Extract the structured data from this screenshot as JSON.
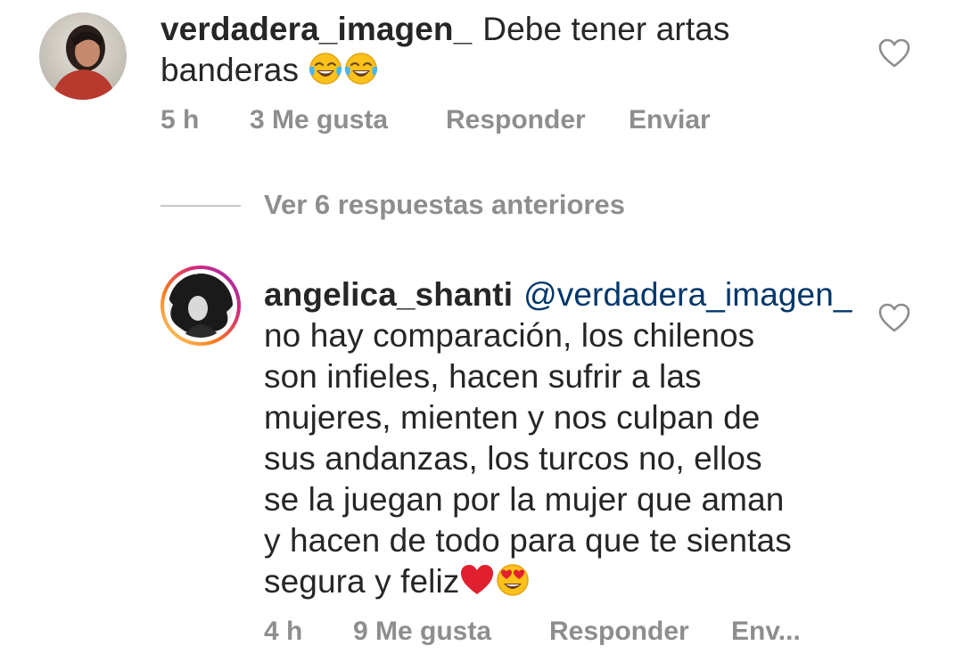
{
  "comment1": {
    "username": "verdadera_imagen_",
    "text_line1": "Debe tener artas",
    "text_line2": "banderas",
    "emojis": [
      "face-with-tears-of-joy-emoji",
      "face-with-tears-of-joy-emoji"
    ],
    "time": "5 h",
    "likes": "3 Me gusta",
    "reply_label": "Responder",
    "send_label": "Enviar"
  },
  "view_replies": {
    "label": "Ver 6 respuestas anteriores"
  },
  "comment2": {
    "username": "angelica_shanti",
    "mention": "@verdadera_imagen_",
    "lines": [
      "no hay comparación, los chilenos",
      "son infieles, hacen sufrir a las",
      "mujeres, mienten y nos culpan de",
      "sus andanzas, los turcos no, ellos",
      "se la juegan por la mujer que aman",
      "y hacen de todo para que te sientas",
      "segura y feliz"
    ],
    "emojis": [
      "red-heart-emoji",
      "heart-eyes-emoji"
    ],
    "time": "4 h",
    "likes": "9 Me gusta",
    "reply_label": "Responder",
    "send_label": "Env..."
  },
  "colors": {
    "text": "#262626",
    "secondary": "#8e8e8e",
    "mention": "#00376b",
    "divider": "#c7c7c7",
    "story_ring_start": "#feda75",
    "story_ring_end": "#d62976"
  }
}
